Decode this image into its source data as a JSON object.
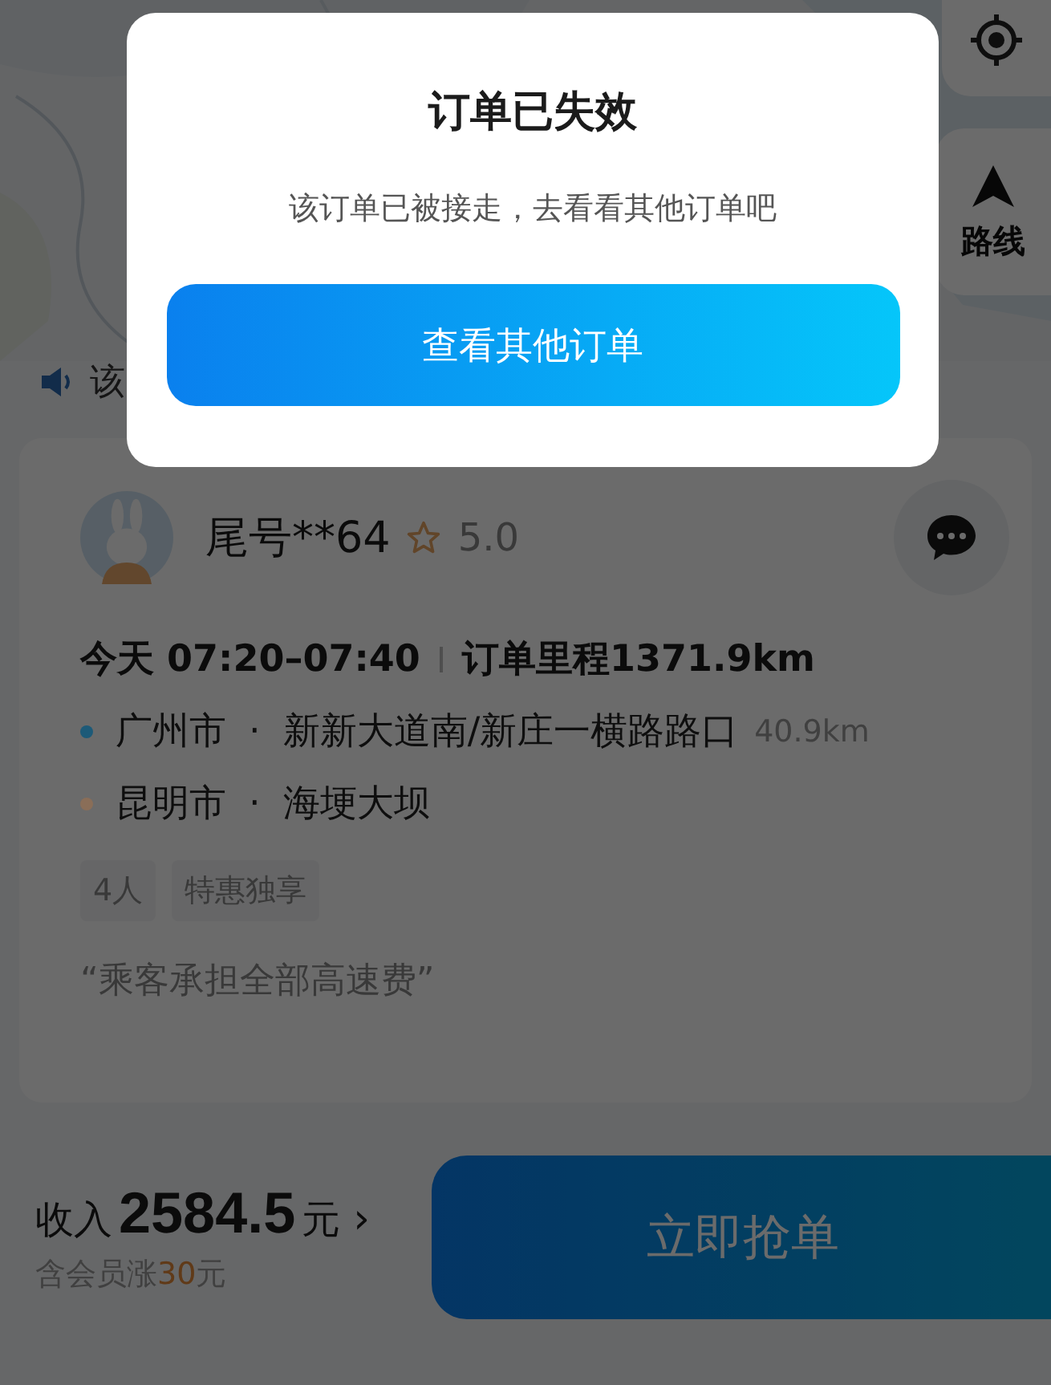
{
  "map": {
    "route_button": {
      "label": "路线"
    }
  },
  "notice": {
    "text": "该"
  },
  "passenger": {
    "name": "尾号**64",
    "rating": "5.0"
  },
  "trip": {
    "time": "今天 07:20–07:40",
    "mileage": "订单里程1371.9km"
  },
  "stops": [
    {
      "city": "广州市",
      "separator": "·",
      "place": "新新大道南/新庄一横路路口",
      "distance": "40.9km",
      "color": "#1d5a78"
    },
    {
      "city": "昆明市",
      "separator": "·",
      "place": "海埂大坝",
      "color": "#8a6e58"
    }
  ],
  "tags": [
    "4人",
    "特惠独享"
  ],
  "remark": "“乘客承担全部高速费”",
  "footer": {
    "income_label": "收入",
    "income_amount": "2584.5",
    "income_unit": "元",
    "chevron": "›",
    "bonus_before": "含会员涨",
    "bonus_amount": "30",
    "bonus_after": "元",
    "grab_button": "立即抢单"
  },
  "dialog": {
    "title": "订单已失效",
    "message": "该订单已被接走，去看看其他订单吧",
    "button": "查看其他订单"
  }
}
